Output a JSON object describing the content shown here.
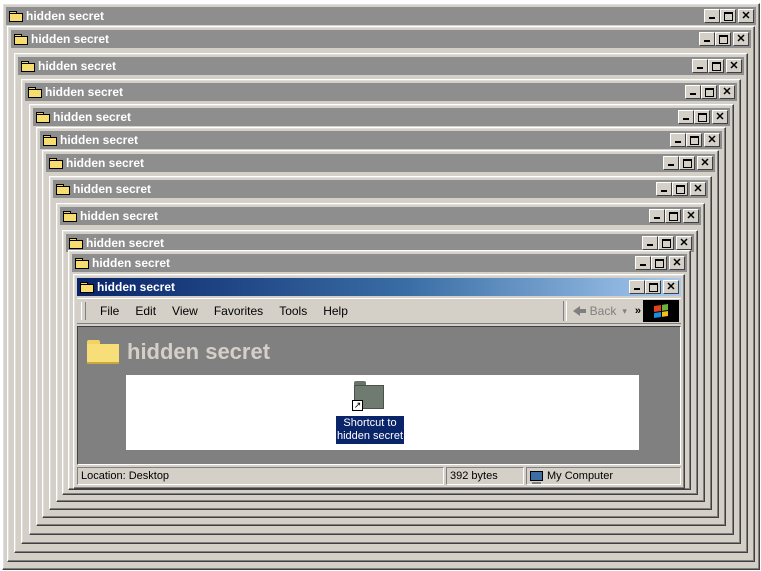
{
  "window_title": "hidden secret",
  "menu": [
    "File",
    "Edit",
    "View",
    "Favorites",
    "Tools",
    "Help"
  ],
  "toolbar": {
    "back_label": "Back",
    "more_glyph": "»"
  },
  "folder_header_title": "hidden secret",
  "file_item": {
    "name": "Shortcut to hidden secret",
    "icon": "folder-shortcut-icon"
  },
  "status": {
    "location": "Location: Desktop",
    "size": "392 bytes",
    "zone": "My Computer"
  },
  "colors": {
    "active_title": "#0a246a",
    "inactive_title": "#8e8e8e",
    "selection": "#0a246a"
  }
}
